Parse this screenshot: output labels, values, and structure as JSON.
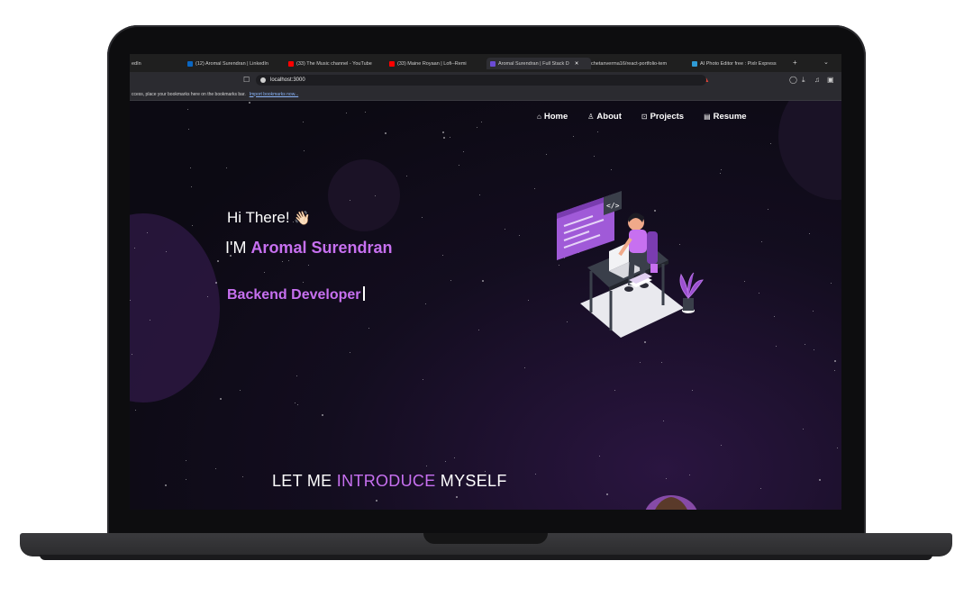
{
  "browser": {
    "tabs": [
      {
        "label": "edIn",
        "favicon_color": "#0a66c2"
      },
      {
        "label": "(12) Aromal Surendran | LinkedIn",
        "favicon_color": "#0a66c2",
        "favicon_text": "in"
      },
      {
        "label": "(33) The Music channel - YouTube",
        "favicon_color": "#ff0000"
      },
      {
        "label": "(33) Maine Royaan | Lofi--Remi",
        "favicon_color": "#ff0000"
      },
      {
        "label": "Aromal Surendran | Full Stack D",
        "favicon_color": "#6b4bd6",
        "active": true
      },
      {
        "label": "chetanverma16/react-portfolio-tem",
        "favicon_color": "#2b2b30"
      },
      {
        "label": "AI Photo Editor free : Pixlr Express",
        "favicon_color": "#2f9bd6"
      }
    ],
    "new_tab": "+",
    "url": "localhost:3000",
    "bookmarks_text": "ccess, place your bookmarks here on the bookmarks bar.",
    "bookmarks_link": "Import bookmarks now..."
  },
  "nav": {
    "home": "Home",
    "about": "About",
    "projects": "Projects",
    "resume": "Resume"
  },
  "hero": {
    "greeting": "Hi There!",
    "wave": "👋🏻",
    "im_prefix": "I'M ",
    "name": "Aromal Surendran",
    "role": "Backend Developer"
  },
  "intro": {
    "part1": "LET ME ",
    "highlight": "INTRODUCE",
    "part2": " MYSELF"
  },
  "colors": {
    "accent": "#c770f0",
    "background": "#0c0a13"
  },
  "icons": {
    "home": "home-icon",
    "about": "user-icon",
    "projects": "projects-icon",
    "resume": "resume-icon"
  }
}
